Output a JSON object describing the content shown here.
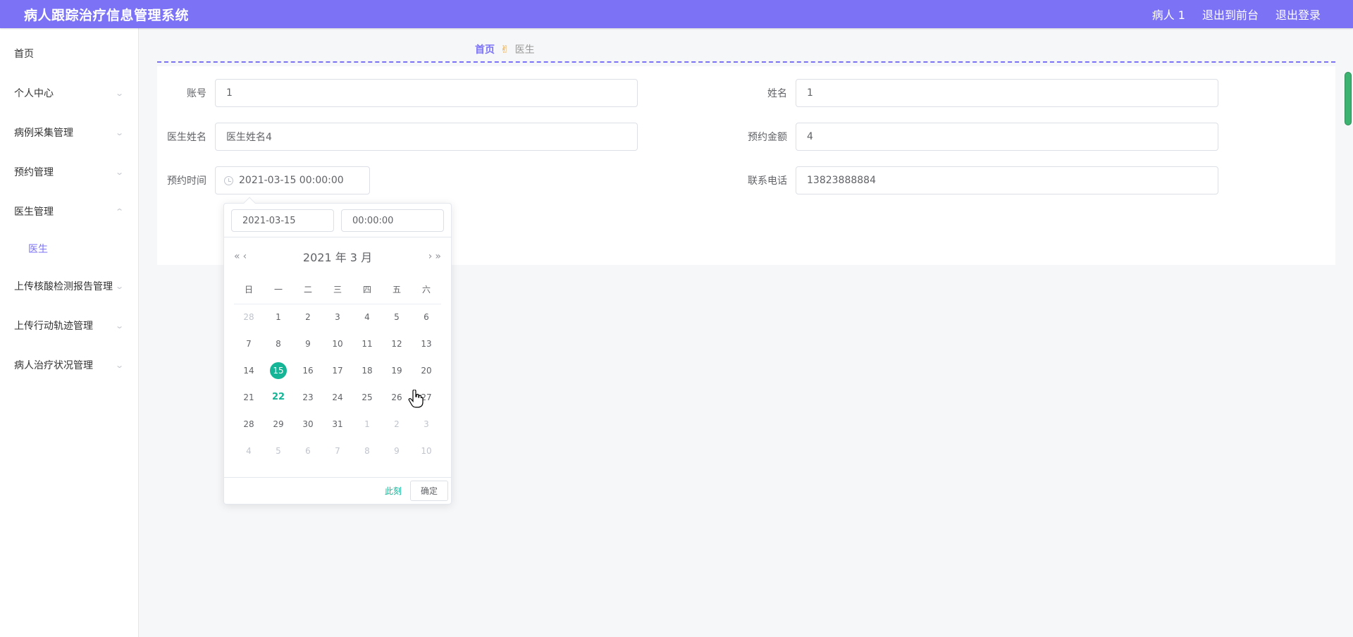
{
  "header": {
    "title": "病人跟踪治疗信息管理系统",
    "user": "病人 1",
    "to_front": "退出到前台",
    "logout": "退出登录"
  },
  "sidebar": {
    "items": [
      {
        "label": "首页"
      },
      {
        "label": "个人中心"
      },
      {
        "label": "病例采集管理"
      },
      {
        "label": "预约管理"
      },
      {
        "label": "医生管理"
      },
      {
        "label": "医生"
      },
      {
        "label": "上传核酸检测报告管理"
      },
      {
        "label": "上传行动轨迹管理"
      },
      {
        "label": "病人治疗状况管理"
      }
    ]
  },
  "breadcrumb": {
    "home": "首页",
    "current": "医生"
  },
  "form": {
    "account_label": "账号",
    "account_value": "1",
    "name_label": "姓名",
    "name_value": "1",
    "doctor_label": "医生姓名",
    "doctor_value": "医生姓名4",
    "amount_label": "预约金额",
    "amount_value": "4",
    "time_label": "预约时间",
    "time_value": "2021-03-15 00:00:00",
    "phone_label": "联系电话",
    "phone_value": "13823888884"
  },
  "picker": {
    "date_input": "2021-03-15",
    "time_input": "00:00:00",
    "year_month": "2021 年  3 月",
    "weekdays": [
      "日",
      "一",
      "二",
      "三",
      "四",
      "五",
      "六"
    ],
    "weeks": [
      [
        "28",
        "1",
        "2",
        "3",
        "4",
        "5",
        "6"
      ],
      [
        "7",
        "8",
        "9",
        "10",
        "11",
        "12",
        "13"
      ],
      [
        "14",
        "15",
        "16",
        "17",
        "18",
        "19",
        "20"
      ],
      [
        "21",
        "22",
        "23",
        "24",
        "25",
        "26",
        "27"
      ],
      [
        "28",
        "29",
        "30",
        "31",
        "1",
        "2",
        "3"
      ],
      [
        "4",
        "5",
        "6",
        "7",
        "8",
        "9",
        "10"
      ]
    ],
    "now_label": "此刻",
    "ok_label": "确定"
  }
}
